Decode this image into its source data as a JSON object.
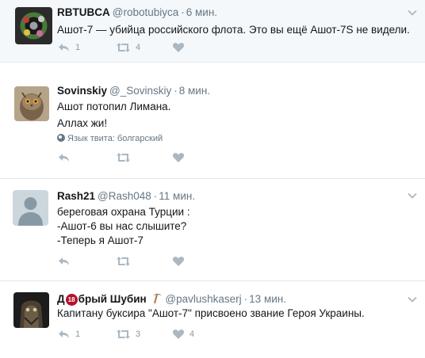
{
  "tweets": [
    {
      "fullname": "RBTUBCA",
      "username": "@robotubiyca",
      "sep": "·",
      "time": "6 мин.",
      "lines": [
        "Ашот-7 — убийца российского флота. Это вы ещё Ашот-7S не видели."
      ],
      "reply_count": "1",
      "retweet_count": "4",
      "like_count": ""
    },
    {
      "fullname": "Sovinskiy",
      "username": "@_Sovinskiy",
      "sep": "·",
      "time": "8 мин.",
      "lines": [
        "Ашот потопил Лимана.",
        "Аллах жи!"
      ],
      "language": "Язык твита: болгарский",
      "reply_count": "",
      "retweet_count": "",
      "like_count": ""
    },
    {
      "fullname": "Rash21",
      "username": "@Rash048",
      "sep": "·",
      "time": "11 мин.",
      "lines": [
        "береговая охрана Турции :",
        "-Ашот-6 вы нас слышите?",
        "-Теперь я Ашот-7"
      ],
      "reply_count": "",
      "retweet_count": "",
      "like_count": ""
    },
    {
      "fullname_a": "Д",
      "badge": "18",
      "fullname_b": "брый Шубин",
      "username": "@pavlushkaserj",
      "sep": "·",
      "time": "13 мин.",
      "lines": [
        "Капитану буксира \"Ашот-7\" присвоено звание Героя Украины."
      ],
      "reply_count": "1",
      "retweet_count": "3",
      "like_count": "4"
    }
  ],
  "colors": {
    "highlight_bg": "#f5f8fa",
    "divider": "#e1e8ed",
    "muted": "#657786",
    "icon": "#aab8c2",
    "badge": "#b3122b"
  },
  "icons": [
    "avatar",
    "chevron-down-icon",
    "reply-icon",
    "retweet-icon",
    "like-icon",
    "globe-icon",
    "pickaxe-icon"
  ]
}
